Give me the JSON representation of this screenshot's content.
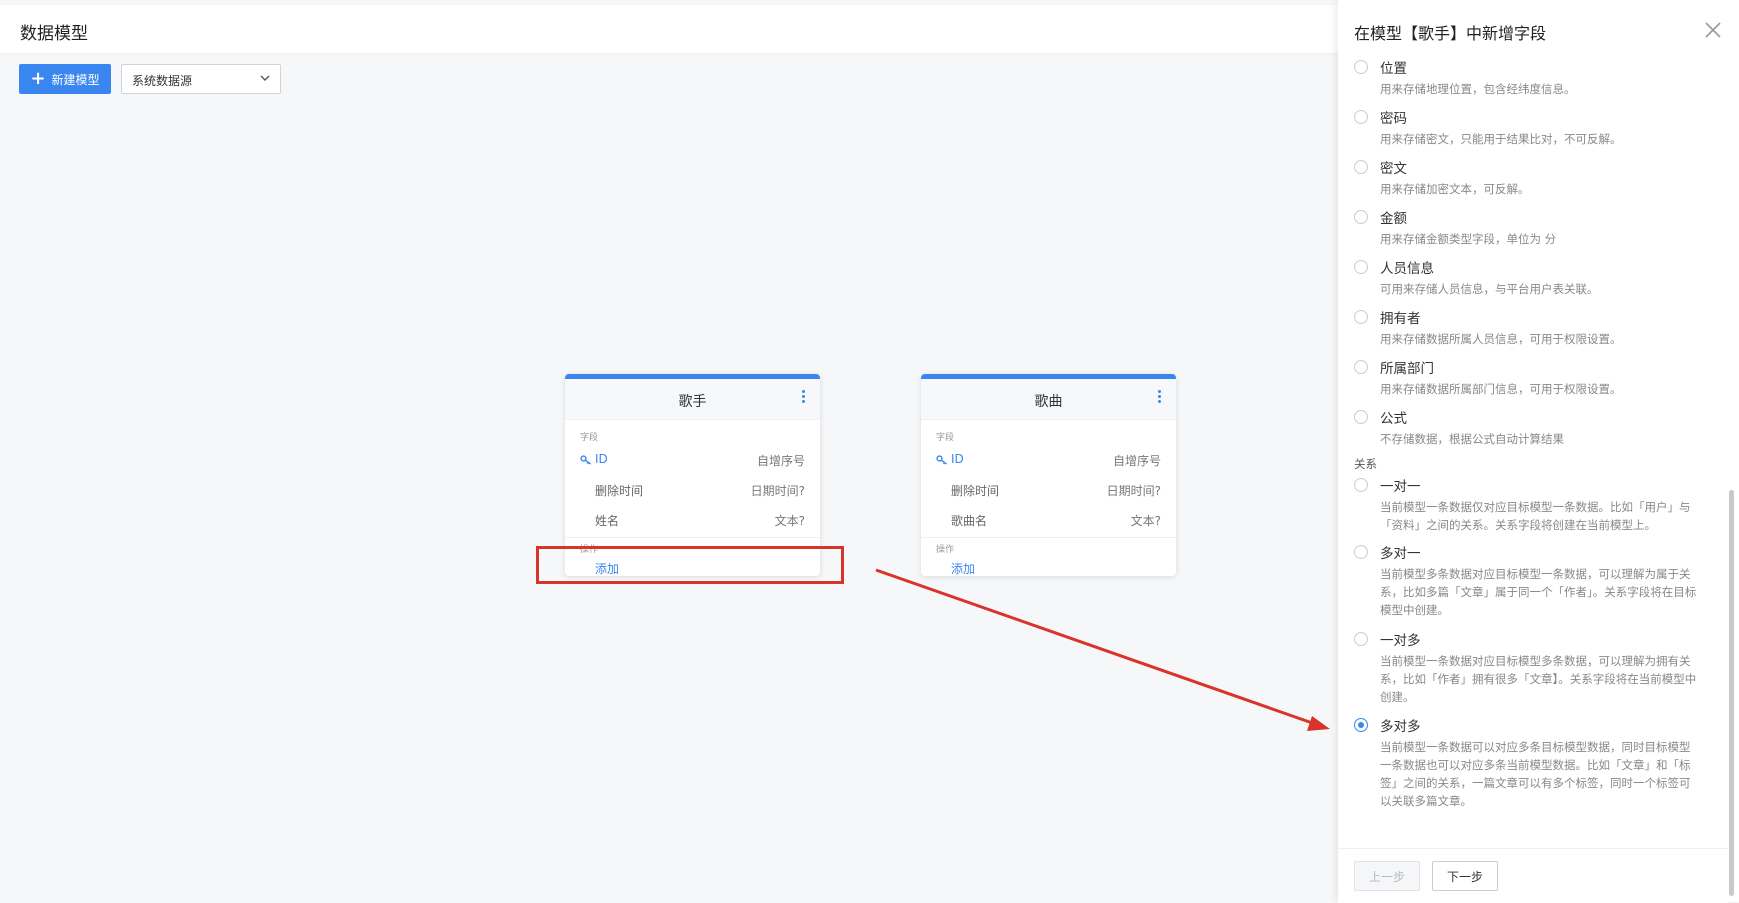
{
  "header": {
    "title": "数据模型"
  },
  "toolbar": {
    "new_model_label": "新建模型",
    "datasource_value": "系统数据源"
  },
  "cards": [
    {
      "title": "歌手",
      "fields_label": "字段",
      "fields": [
        {
          "name": "ID",
          "type": "自增序号"
        },
        {
          "name": "删除时间",
          "type": "日期时间?"
        },
        {
          "name": "姓名",
          "type": "文本?"
        }
      ],
      "actions_label": "操作",
      "add_label": "添加"
    },
    {
      "title": "歌曲",
      "fields_label": "字段",
      "fields": [
        {
          "name": "ID",
          "type": "自增序号"
        },
        {
          "name": "删除时间",
          "type": "日期时间?"
        },
        {
          "name": "歌曲名",
          "type": "文本?"
        }
      ],
      "actions_label": "操作",
      "add_label": "添加"
    }
  ],
  "drawer": {
    "title": "在模型【歌手】中新增字段",
    "options": [
      {
        "name": "位置",
        "desc": "用来存储地理位置，包含经纬度信息。",
        "checked": false
      },
      {
        "name": "密码",
        "desc": "用来存储密文，只能用于结果比对，不可反解。",
        "checked": false
      },
      {
        "name": "密文",
        "desc": "用来存储加密文本，可反解。",
        "checked": false
      },
      {
        "name": "金额",
        "desc": "用来存储金额类型字段，单位为 分",
        "checked": false
      },
      {
        "name": "人员信息",
        "desc": "可用来存储人员信息，与平台用户表关联。",
        "checked": false
      },
      {
        "name": "拥有者",
        "desc": "用来存储数据所属人员信息，可用于权限设置。",
        "checked": false
      },
      {
        "name": "所属部门",
        "desc": "用来存储数据所属部门信息，可用于权限设置。",
        "checked": false
      },
      {
        "name": "公式",
        "desc": "不存储数据，根据公式自动计算结果",
        "checked": false
      }
    ],
    "relation_label": "关系",
    "relations": [
      {
        "name": "一对一",
        "desc": "当前模型一条数据仅对应目标模型一条数据。比如「用户」与「资料」之间的关系。关系字段将创建在当前模型上。",
        "checked": false
      },
      {
        "name": "多对一",
        "desc": "当前模型多条数据对应目标模型一条数据，可以理解为属于关系，比如多篇「文章」属于同一个「作者」。关系字段将在目标模型中创建。",
        "checked": false
      },
      {
        "name": "一对多",
        "desc": "当前模型一条数据对应目标模型多条数据，可以理解为拥有关系，比如「作者」拥有很多「文章】。关系字段将在当前模型中创建。",
        "checked": false
      },
      {
        "name": "多对多",
        "desc": "当前模型一条数据可以对应多条目标模型数据，同时目标模型一条数据也可以对应多条当前模型数据。比如「文章」和「标签」之间的关系，一篇文章可以有多个标签，同时一个标签可以关联多篇文章。",
        "checked": true
      }
    ],
    "prev_label": "上一步",
    "next_label": "下一步"
  },
  "colors": {
    "accent": "#3a86f0",
    "annotation": "#d9342b"
  }
}
